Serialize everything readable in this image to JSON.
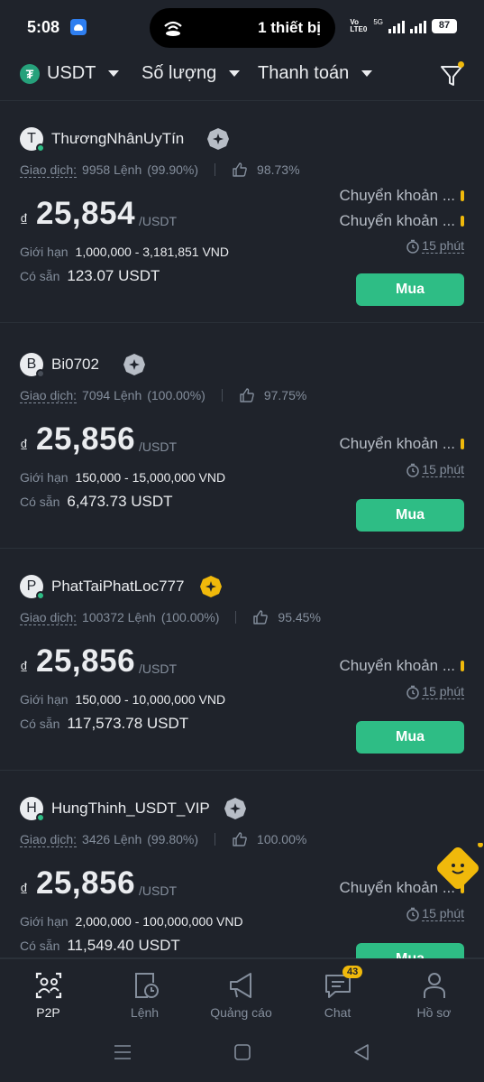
{
  "status_bar": {
    "time": "5:08",
    "island_text": "1 thiết bị",
    "network_label": "5G",
    "volte_label": "Vo LTE0",
    "battery": "87"
  },
  "filters": {
    "coin": "USDT",
    "amount": "Số lượng",
    "payment": "Thanh toán"
  },
  "ads": [
    {
      "avatar_letter": "T",
      "online_color": "#2ebd85",
      "merchant": "ThươngNhânUyTín",
      "badge": "silver",
      "trade_label": "Giao dịch:",
      "orders": "9958 Lệnh",
      "completion": "(99.90%)",
      "rating": "98.73%",
      "currency": "₫",
      "price": "25,854",
      "unit": "/USDT",
      "limit_label": "Giới hạn",
      "limit": "1,000,000 - 3,181,851 VND",
      "available_label": "Có sẵn",
      "available": "123.07 USDT",
      "payments": [
        "Chuyển khoản ...",
        "Chuyển khoản ..."
      ],
      "time_limit": "15 phút",
      "buy_label": "Mua"
    },
    {
      "avatar_letter": "B",
      "online_color": "#474d57",
      "merchant": "Bi0702",
      "badge": "silver",
      "trade_label": "Giao dịch:",
      "orders": "7094 Lệnh",
      "completion": "(100.00%)",
      "rating": "97.75%",
      "currency": "₫",
      "price": "25,856",
      "unit": "/USDT",
      "limit_label": "Giới hạn",
      "limit": "150,000 - 15,000,000 VND",
      "available_label": "Có sẵn",
      "available": "6,473.73 USDT",
      "payments": [
        "Chuyển khoản ..."
      ],
      "time_limit": "15 phút",
      "buy_label": "Mua"
    },
    {
      "avatar_letter": "P",
      "online_color": "#2ebd85",
      "merchant": "PhatTaiPhatLoc777",
      "badge": "gold",
      "trade_label": "Giao dịch:",
      "orders": "100372 Lệnh",
      "completion": "(100.00%)",
      "rating": "95.45%",
      "currency": "₫",
      "price": "25,856",
      "unit": "/USDT",
      "limit_label": "Giới hạn",
      "limit": "150,000 - 10,000,000 VND",
      "available_label": "Có sẵn",
      "available": "117,573.78 USDT",
      "payments": [
        "Chuyển khoản ..."
      ],
      "time_limit": "15 phút",
      "buy_label": "Mua"
    },
    {
      "avatar_letter": "H",
      "online_color": "#2ebd85",
      "merchant": "HungThinh_USDT_VIP",
      "badge": "silver",
      "trade_label": "Giao dịch:",
      "orders": "3426 Lệnh",
      "completion": "(99.80%)",
      "rating": "100.00%",
      "currency": "₫",
      "price": "25,856",
      "unit": "/USDT",
      "limit_label": "Giới hạn",
      "limit": "2,000,000 - 100,000,000 VND",
      "available_label": "Có sẵn",
      "available": "11,549.40 USDT",
      "payments": [
        "Chuyển khoản ..."
      ],
      "time_limit": "15 phút",
      "buy_label": "Mua"
    }
  ],
  "bottom_nav": [
    {
      "label": "P2P",
      "icon": "p2p-icon",
      "active": true
    },
    {
      "label": "Lệnh",
      "icon": "orders-icon",
      "active": false
    },
    {
      "label": "Quảng cáo",
      "icon": "megaphone-icon",
      "active": false
    },
    {
      "label": "Chat",
      "icon": "chat-icon",
      "active": false,
      "badge": "43"
    },
    {
      "label": "Hồ sơ",
      "icon": "profile-icon",
      "active": false
    }
  ],
  "colors": {
    "background": "#1f232b",
    "buy": "#2ebd85",
    "accent": "#f0b90b",
    "muted": "#848e9c"
  }
}
